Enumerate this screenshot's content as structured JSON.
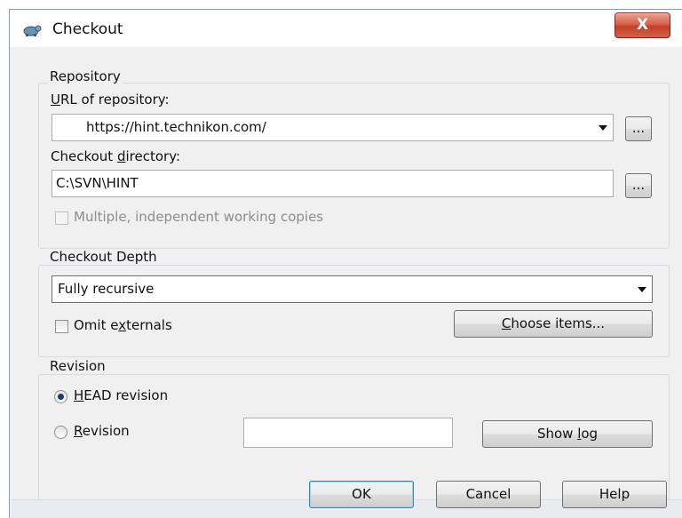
{
  "window": {
    "title": "Checkout",
    "close_label": "X",
    "icon": "tortoise-svn-icon"
  },
  "repository": {
    "group_label": "Repository",
    "url_label": "URL of repository:",
    "url_value": "https://hint.technikon.com/",
    "browse_label": "...",
    "dir_label": "Checkout directory:",
    "dir_value": "C:\\SVN\\HINT",
    "dir_browse_label": "...",
    "multiple_label": "Multiple, independent working copies",
    "multiple_checked": false
  },
  "depth": {
    "group_label": "Checkout Depth",
    "selected": "Fully recursive",
    "omit_label": "Omit externals",
    "omit_checked": false,
    "choose_label": "Choose items..."
  },
  "revision": {
    "group_label": "Revision",
    "head_label": "HEAD revision",
    "head_selected": true,
    "rev_label": "Revision",
    "rev_value": "",
    "show_log_label": "Show log"
  },
  "footer": {
    "ok_label": "OK",
    "cancel_label": "Cancel",
    "help_label": "Help"
  }
}
